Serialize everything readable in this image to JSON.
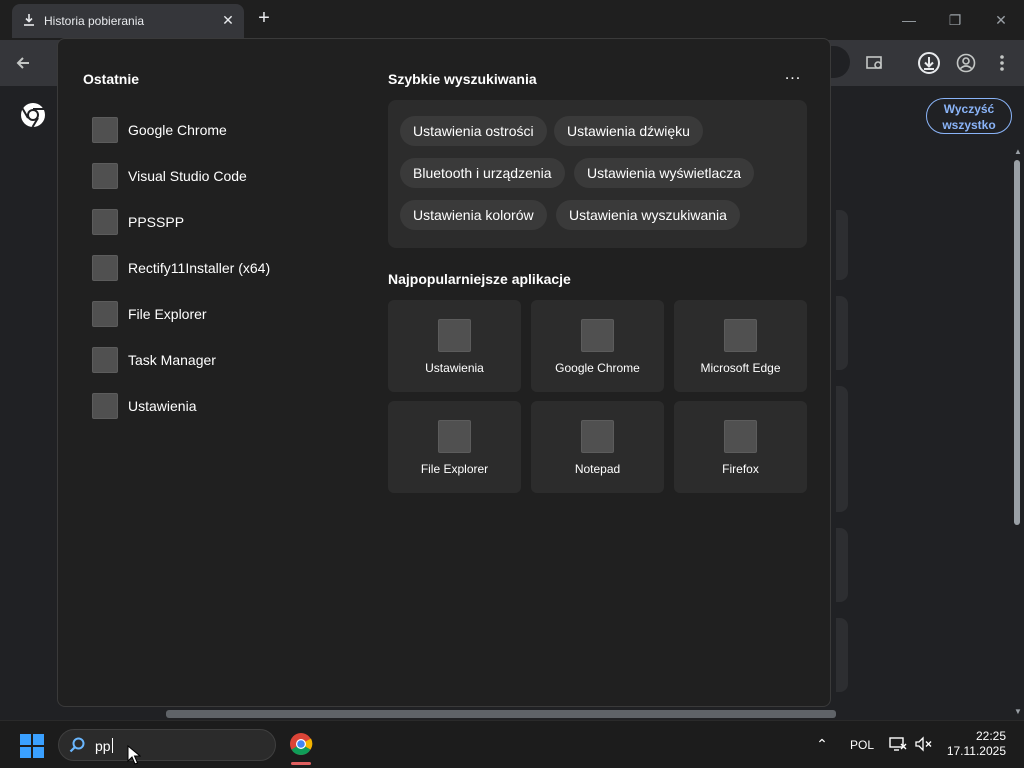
{
  "browser": {
    "tab_title": "Historia pobierania",
    "clear_all_label": "Wyczyść wszystko"
  },
  "flyout": {
    "recent": {
      "title": "Ostatnie",
      "items": [
        {
          "label": "Google Chrome"
        },
        {
          "label": "Visual Studio Code"
        },
        {
          "label": "PPSSPP"
        },
        {
          "label": "Rectify11Installer (x64)"
        },
        {
          "label": "File Explorer"
        },
        {
          "label": "Task Manager"
        },
        {
          "label": "Ustawienia"
        }
      ]
    },
    "quick_searches": {
      "title": "Szybkie wyszukiwania",
      "more_label": "...",
      "chips": [
        "Ustawienia ostrości",
        "Ustawienia dźwięku",
        "Bluetooth i urządzenia",
        "Ustawienia wyświetlacza",
        "Ustawienia kolorów",
        "Ustawienia wyszukiwania"
      ]
    },
    "top_apps": {
      "title": "Najpopularniejsze aplikacje",
      "apps": [
        "Ustawienia",
        "Google Chrome",
        "Microsoft Edge",
        "File Explorer",
        "Notepad",
        "Firefox"
      ]
    }
  },
  "taskbar": {
    "search_value": "pp",
    "language": "POL",
    "time": "22:25",
    "date": "17.11.2025"
  },
  "colors": {
    "accent": "#8ab4f8",
    "flyout_bg": "#202020",
    "panel_bg": "#2c2c2c"
  }
}
